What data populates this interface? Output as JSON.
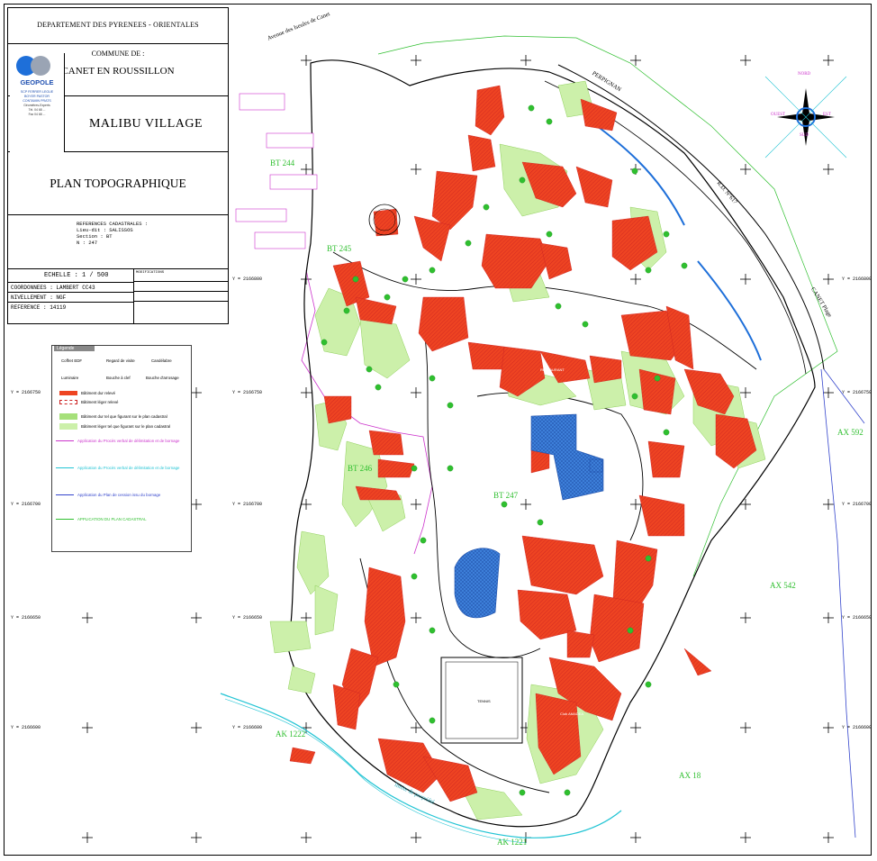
{
  "title_block": {
    "department": "DEPARTEMENT DES PYRENEES - ORIENTALES",
    "commune_label": "COMMUNE DE :",
    "commune": "CANET EN ROUSSILLON",
    "site": "MALIBU VILLAGE",
    "plan": "PLAN TOPOGRAPHIQUE",
    "references_lines": [
      "REFERENCES CADASTRALES :",
      "Lieu-dit : SALISSOS",
      "Section : BT",
      "N : 247"
    ],
    "scale": "ECHELLE : 1 / 500",
    "coordinates": "COORDONNEES : LAMBERT CC43",
    "levelling": "NIVELLEMENT : NGF",
    "reference": "REFERENCE : 14119",
    "revision_header": "MODIFICATIONS"
  },
  "logo": {
    "name": "GEOPOLE",
    "lines": [
      "SCP FERRER LEGUE",
      "BOYER PASTOR",
      "CONTAMIN PRATS",
      "Géomètres-Experts",
      "Tél. 04 68 ...",
      "Fax 04 68 ..."
    ]
  },
  "legend": {
    "title": "Légende",
    "symbols": [
      "Coffret EDF",
      "Regard de visite",
      "Candélabre",
      "Luminaire",
      "Bouche à clef",
      "Bouche d'arrosage"
    ],
    "items": [
      {
        "text": "Bâtiment dur relevé",
        "color": "#ee4422"
      },
      {
        "text": "Bâtiment léger relevé",
        "color": "#ffffff"
      },
      {
        "text": "Bâtiment dur tel que figurant sur le plan cadastral",
        "color": "#a6e07a"
      },
      {
        "text": "Bâtiment léger tel que figurant sur le plan cadastral",
        "color": "#ccf0aa"
      }
    ],
    "notes": [
      {
        "text": "Application du Procès verbal de délimitation et de bornage",
        "color": "#cc33cc"
      },
      {
        "text": "Application du Procès verbal de délimitation et de bornage",
        "color": "#22c4d4"
      },
      {
        "text": "Application du Plan de cession issu du bornage",
        "color": "#3344cc"
      },
      {
        "text": "APPLICATION DU PLAN CADASTRAL",
        "color": "#2fbf2f"
      }
    ]
  },
  "parcels": [
    "BT 244",
    "BT 245",
    "BT 246",
    "BT 247",
    "AX 592",
    "AX 542",
    "AX 18",
    "AK 1222",
    "AK 1221"
  ],
  "roads": {
    "avenue": "Avenue des Iseules de Canet",
    "perpignan": "PERPIGNAN",
    "rd": "R.D. N°617",
    "canet_plage": "CANET Plage",
    "limit": "limite de propriété"
  },
  "buildings": [
    "RESTAURANT",
    "Club AMADEA",
    "TENNIS"
  ],
  "compass": {
    "north": "NORD",
    "west": "OUEST",
    "east": "EST",
    "south": "SUD"
  },
  "grid_labels": [
    "Y = 2166800",
    "Y = 2166750",
    "Y = 2166700",
    "Y = 2166650",
    "Y = 2166600"
  ],
  "colors": {
    "hard_building": "#ee4422",
    "cadastral_green": "#a6e07a",
    "light_green": "#ccf0aa",
    "pool": "#3d7fd9",
    "magenta": "#cc33cc",
    "cyan": "#22c4d4",
    "blue": "#3344cc",
    "green_line": "#2fbf2f"
  }
}
